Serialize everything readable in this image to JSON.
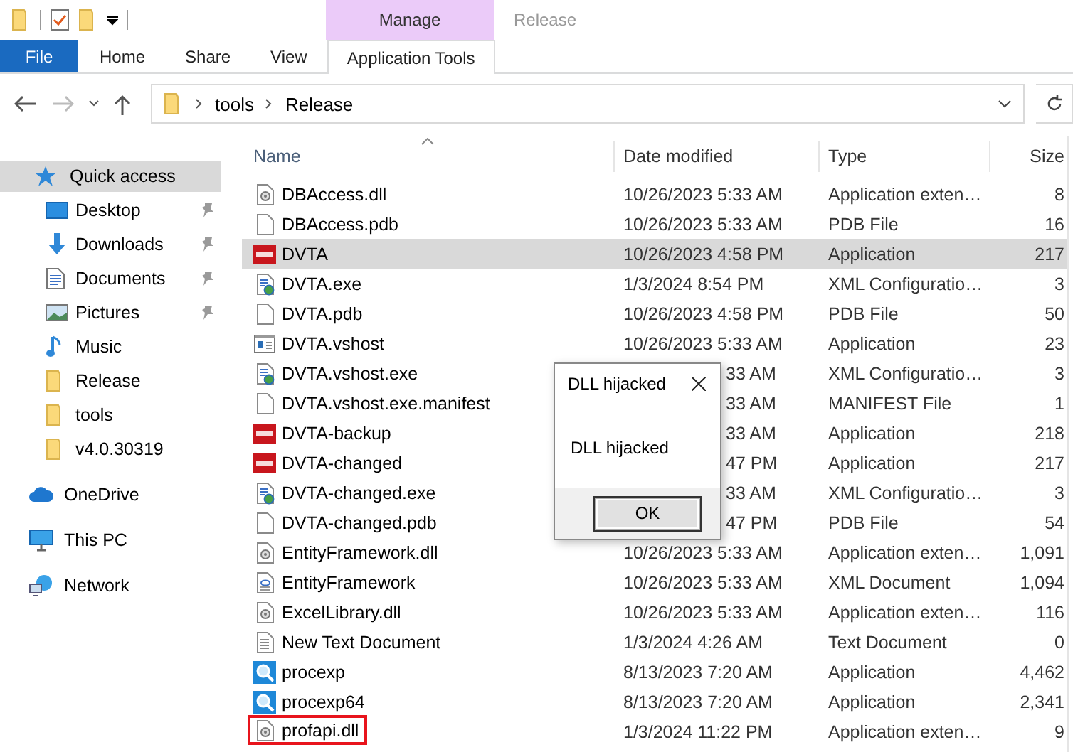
{
  "ribbon": {
    "context_group": "Manage",
    "title": "Release",
    "tabs": [
      {
        "label": "File",
        "kind": "file",
        "selected": false
      },
      {
        "label": "Home",
        "kind": "plain",
        "selected": false
      },
      {
        "label": "Share",
        "kind": "plain",
        "selected": false
      },
      {
        "label": "View",
        "kind": "plain",
        "selected": false
      },
      {
        "label": "Application Tools",
        "kind": "context",
        "selected": true
      }
    ]
  },
  "address_bar": {
    "path": [
      "tools",
      "Release"
    ]
  },
  "sidebar": {
    "items": [
      {
        "label": "Quick access",
        "kind": "star",
        "selected": true,
        "children": [
          {
            "label": "Desktop",
            "kind": "desktop",
            "pinned": true,
            "selected": false
          },
          {
            "label": "Downloads",
            "kind": "downloads",
            "pinned": true,
            "selected": false
          },
          {
            "label": "Documents",
            "kind": "documents",
            "pinned": true,
            "selected": false
          },
          {
            "label": "Pictures",
            "kind": "pictures",
            "pinned": true,
            "selected": false
          },
          {
            "label": "Music",
            "kind": "music",
            "pinned": false,
            "selected": false
          },
          {
            "label": "Release",
            "kind": "folder",
            "pinned": false,
            "selected": false
          },
          {
            "label": "tools",
            "kind": "folder",
            "pinned": false,
            "selected": false
          },
          {
            "label": "v4.0.30319",
            "kind": "folder",
            "pinned": false,
            "selected": false
          }
        ]
      },
      {
        "label": "OneDrive",
        "kind": "cloud",
        "selected": false
      },
      {
        "label": "This PC",
        "kind": "pc",
        "selected": false
      },
      {
        "label": "Network",
        "kind": "network",
        "selected": false
      }
    ]
  },
  "file_list": {
    "columns": [
      {
        "label": "Name",
        "sorted": true
      },
      {
        "label": "Date modified",
        "sorted": false
      },
      {
        "label": "Type",
        "sorted": false
      },
      {
        "label": "Size",
        "sorted": false
      }
    ],
    "rows": [
      {
        "kind": "dll",
        "name": "DBAccess.dll",
        "date": "10/26/2023 5:33 AM",
        "type": "Application exten…",
        "size": "8",
        "selected": false,
        "outlined": false
      },
      {
        "kind": "file",
        "name": "DBAccess.pdb",
        "date": "10/26/2023 5:33 AM",
        "type": "PDB File",
        "size": "16",
        "selected": false,
        "outlined": false
      },
      {
        "kind": "app",
        "name": "DVTA",
        "date": "10/26/2023 4:58 PM",
        "type": "Application",
        "size": "217",
        "selected": true,
        "outlined": false
      },
      {
        "kind": "exe",
        "name": "DVTA.exe",
        "date": "1/3/2024 8:54 PM",
        "type": "XML Configuratio…",
        "size": "3",
        "selected": false,
        "outlined": false
      },
      {
        "kind": "file",
        "name": "DVTA.pdb",
        "date": "10/26/2023 4:58 PM",
        "type": "PDB File",
        "size": "50",
        "selected": false,
        "outlined": false
      },
      {
        "kind": "window",
        "name": "DVTA.vshost",
        "date": "10/26/2023 5:33 AM",
        "type": "Application",
        "size": "23",
        "selected": false,
        "outlined": false
      },
      {
        "kind": "exe",
        "name": "DVTA.vshost.exe",
        "date": "33 AM",
        "date_clipped": true,
        "type": "XML Configuratio…",
        "size": "3",
        "selected": false,
        "outlined": false
      },
      {
        "kind": "file",
        "name": "DVTA.vshost.exe.manifest",
        "date": "33 AM",
        "date_clipped": true,
        "type": "MANIFEST File",
        "size": "1",
        "selected": false,
        "outlined": false
      },
      {
        "kind": "app",
        "name": "DVTA-backup",
        "date": "33 AM",
        "date_clipped": true,
        "type": "Application",
        "size": "218",
        "selected": false,
        "outlined": false
      },
      {
        "kind": "app",
        "name": "DVTA-changed",
        "date": "47 PM",
        "date_clipped": true,
        "type": "Application",
        "size": "217",
        "selected": false,
        "outlined": false
      },
      {
        "kind": "exe",
        "name": "DVTA-changed.exe",
        "date": "33 AM",
        "date_clipped": true,
        "type": "XML Configuratio…",
        "size": "3",
        "selected": false,
        "outlined": false
      },
      {
        "kind": "file",
        "name": "DVTA-changed.pdb",
        "date": "47 PM",
        "date_clipped": true,
        "type": "PDB File",
        "size": "54",
        "selected": false,
        "outlined": false
      },
      {
        "kind": "dll",
        "name": "EntityFramework.dll",
        "date": "10/26/2023 5:33 AM",
        "type": "Application exten…",
        "size": "1,091",
        "selected": false,
        "outlined": false
      },
      {
        "kind": "xml",
        "name": "EntityFramework",
        "date": "10/26/2023 5:33 AM",
        "type": "XML Document",
        "size": "1,094",
        "selected": false,
        "outlined": false
      },
      {
        "kind": "dll",
        "name": "ExcelLibrary.dll",
        "date": "10/26/2023 5:33 AM",
        "type": "Application exten…",
        "size": "116",
        "selected": false,
        "outlined": false
      },
      {
        "kind": "txt",
        "name": "New Text Document",
        "date": "1/3/2024 4:26 AM",
        "type": "Text Document",
        "size": "0",
        "selected": false,
        "outlined": false
      },
      {
        "kind": "search",
        "name": "procexp",
        "date": "8/13/2023 7:20 AM",
        "type": "Application",
        "size": "4,462",
        "selected": false,
        "outlined": false
      },
      {
        "kind": "search",
        "name": "procexp64",
        "date": "8/13/2023 7:20 AM",
        "type": "Application",
        "size": "2,341",
        "selected": false,
        "outlined": false
      },
      {
        "kind": "dll",
        "name": "profapi.dll",
        "date": "1/3/2024 11:22 PM",
        "type": "Application exten…",
        "size": "9",
        "selected": false,
        "outlined": true
      }
    ]
  },
  "dialog": {
    "title": "DLL hijacked",
    "message": "DLL hijacked",
    "button": "OK"
  }
}
